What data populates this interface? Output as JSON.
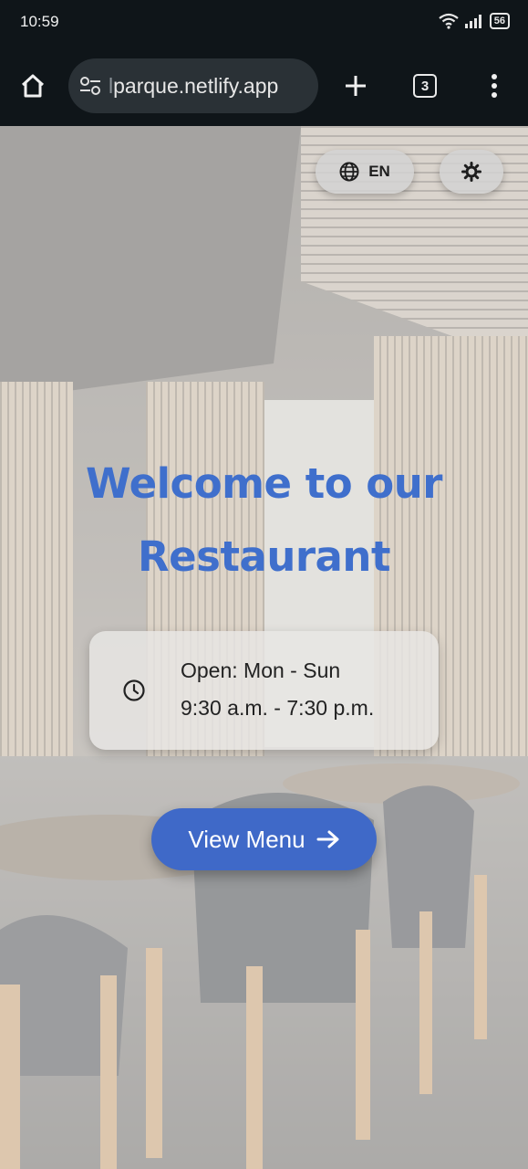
{
  "status_bar": {
    "time": "10:59",
    "battery": "56"
  },
  "browser": {
    "url_prefix": "l",
    "url": "parque.netlify.app",
    "tab_count": "3"
  },
  "header": {
    "language_label": "EN"
  },
  "hero": {
    "title": "Welcome to our Restaurant"
  },
  "hours": {
    "days": "Open: Mon - Sun",
    "times": "9:30 a.m. - 7:30 p.m."
  },
  "cta": {
    "label": "View Menu"
  },
  "colors": {
    "accent": "#3f69c8",
    "title": "#3f6fcc",
    "chrome": "#0f1519"
  }
}
